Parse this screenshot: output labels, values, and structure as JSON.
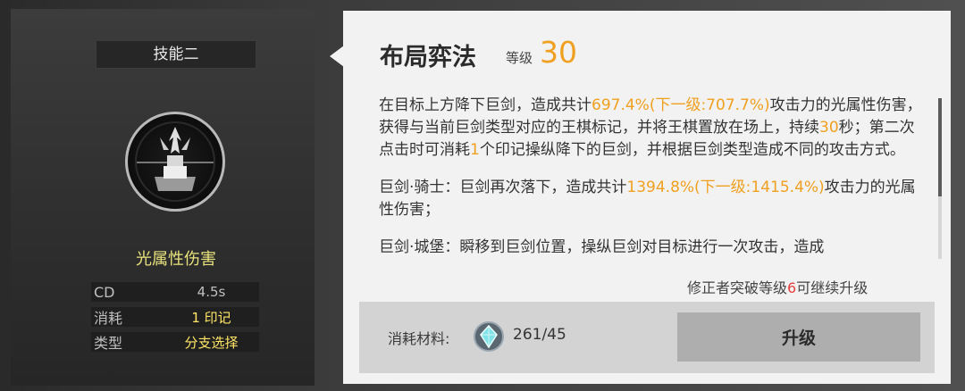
{
  "left_panel": {
    "skill_title": "技能二",
    "icon": "knight-chess-skill-icon",
    "damage_type": "光属性伤害",
    "stats": [
      {
        "key": "CD",
        "value": "4.5s",
        "color": "#bfbfbf"
      },
      {
        "key": "消耗",
        "value": "1 印记",
        "color": "#ffe566"
      },
      {
        "key": "类型",
        "value": "分支选择",
        "color": "#ffe566"
      }
    ]
  },
  "card": {
    "skill_name": "布局弈法",
    "level_label": "等级",
    "level_value": "30",
    "desc_1": [
      {
        "t": "在目标上方降下巨剑，造成共计"
      },
      {
        "t": "697.4%(下一级:707.7%)",
        "hl": true
      },
      {
        "t": "攻击力的光属性伤害，获得与当前巨剑类型对应的王棋标记，并将王棋置放在场上，持续"
      },
      {
        "t": "30",
        "hl": true
      },
      {
        "t": "秒；第二次点击时可消耗"
      },
      {
        "t": "1",
        "hl": true
      },
      {
        "t": "个印记操纵降下的巨剑，并根据巨剑类型造成不同的攻击方式。"
      }
    ],
    "desc_2": [
      {
        "t": "巨剑·骑士：巨剑再次落下，造成共计"
      },
      {
        "t": "1394.8%(下一级:1415.4%)",
        "hl": true
      },
      {
        "t": "攻击力的光属性伤害；"
      }
    ],
    "desc_3": [
      {
        "t": "巨剑·城堡：瞬移到巨剑位置，操纵巨剑对目标进行一次攻击，造成"
      }
    ],
    "unlock_note": [
      {
        "t": "修正者突破等级"
      },
      {
        "t": "6",
        "hl": true,
        "color": "#e64040"
      },
      {
        "t": "可继续升级"
      }
    ],
    "material_label": "消耗材料:",
    "material_icon": "crystal-material-icon",
    "material_count": "261/45",
    "upgrade_label": "升级"
  },
  "colors": {
    "highlight": "#f0a020",
    "warning": "#e64040",
    "stat_yellow": "#ffe566",
    "damage_type": "#e8e27c"
  }
}
